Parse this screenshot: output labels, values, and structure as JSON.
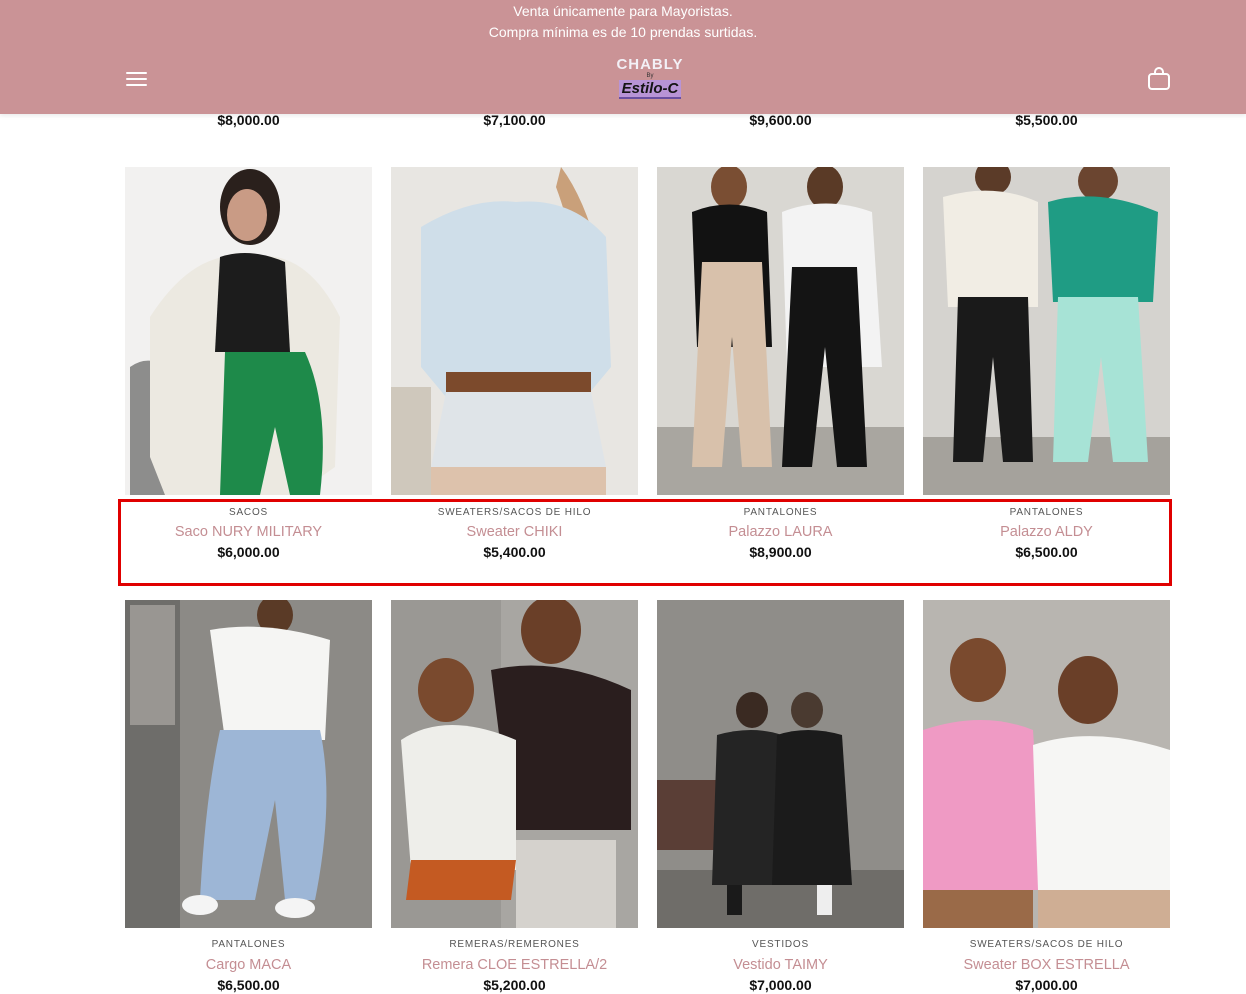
{
  "header": {
    "notice_line1": "Venta únicamente para Mayoristas.",
    "notice_line2": "Compra mínima es de 10 prendas surtidas.",
    "logo_main": "CHABLY",
    "logo_by": "By",
    "logo_sub": "Estilo-C",
    "background_color": "#ca9396",
    "menu_icon": "hamburger-menu-icon",
    "cart_icon": "shopping-bag-icon"
  },
  "previous_row": {
    "prices": [
      "$8,000.00",
      "$7,100.00",
      "$9,600.00",
      "$5,500.00"
    ]
  },
  "products": [
    {
      "category": "SACOS",
      "name": "Saco NURY MILITARY",
      "price": "$6,000.00"
    },
    {
      "category": "SWEATERS/SACOS DE HILO",
      "name": "Sweater CHIKI",
      "price": "$5,400.00"
    },
    {
      "category": "PANTALONES",
      "name": "Palazzo LAURA",
      "price": "$8,900.00"
    },
    {
      "category": "PANTALONES",
      "name": "Palazzo ALDY",
      "price": "$6,500.00"
    },
    {
      "category": "PANTALONES",
      "name": "Cargo MACA",
      "price": "$6,500.00"
    },
    {
      "category": "REMERAS/REMERONES",
      "name": "Remera CLOE ESTRELLA/2",
      "price": "$5,200.00"
    },
    {
      "category": "VESTIDOS",
      "name": "Vestido TAIMY",
      "price": "$7,000.00"
    },
    {
      "category": "SWEATERS/SACOS DE HILO",
      "name": "Sweater BOX ESTRELLA",
      "price": "$7,000.00"
    }
  ],
  "colors": {
    "product_name": "#c48e93",
    "highlight_border": "#e00000"
  }
}
